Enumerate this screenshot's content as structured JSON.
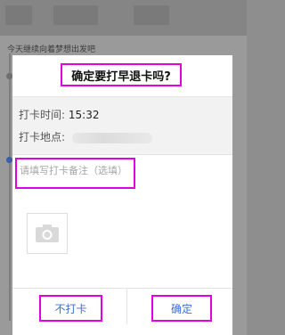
{
  "background": {
    "slogan": "今天继续向着梦想出发吧"
  },
  "dialog": {
    "title": "确定要打早退卡吗?",
    "time_label": "打卡时间:",
    "time_value": "15:32",
    "location_label": "打卡地点:",
    "remark_placeholder": "请填写打卡备注（选填）",
    "photo_icon": "camera-icon",
    "cancel_label": "不打卡",
    "confirm_label": "确定"
  },
  "colors": {
    "link_blue": "#3b6fd6",
    "highlight": "#e000e0"
  }
}
